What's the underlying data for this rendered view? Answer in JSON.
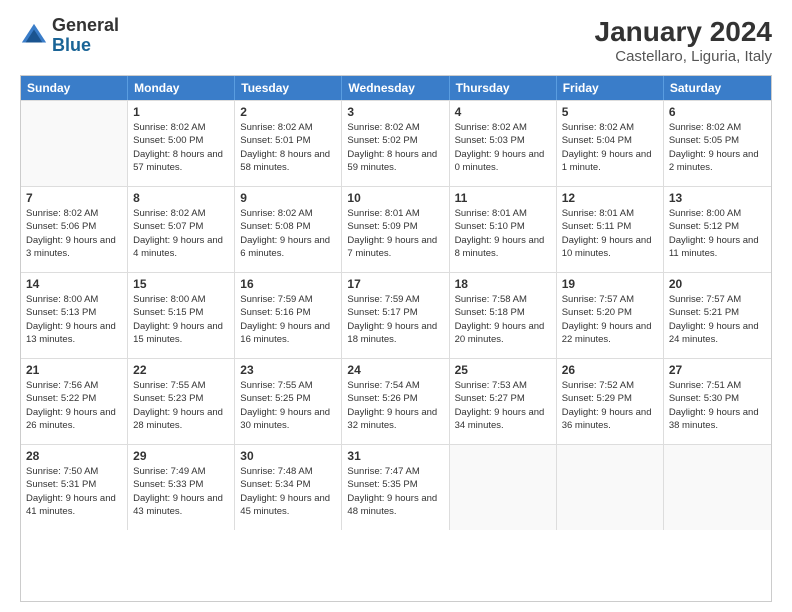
{
  "header": {
    "logo": {
      "general": "General",
      "blue": "Blue"
    },
    "title": "January 2024",
    "subtitle": "Castellaro, Liguria, Italy"
  },
  "calendar": {
    "days_of_week": [
      "Sunday",
      "Monday",
      "Tuesday",
      "Wednesday",
      "Thursday",
      "Friday",
      "Saturday"
    ],
    "weeks": [
      [
        {
          "day": "",
          "empty": true
        },
        {
          "day": "1",
          "sunrise": "Sunrise: 8:02 AM",
          "sunset": "Sunset: 5:00 PM",
          "daylight": "Daylight: 8 hours and 57 minutes."
        },
        {
          "day": "2",
          "sunrise": "Sunrise: 8:02 AM",
          "sunset": "Sunset: 5:01 PM",
          "daylight": "Daylight: 8 hours and 58 minutes."
        },
        {
          "day": "3",
          "sunrise": "Sunrise: 8:02 AM",
          "sunset": "Sunset: 5:02 PM",
          "daylight": "Daylight: 8 hours and 59 minutes."
        },
        {
          "day": "4",
          "sunrise": "Sunrise: 8:02 AM",
          "sunset": "Sunset: 5:03 PM",
          "daylight": "Daylight: 9 hours and 0 minutes."
        },
        {
          "day": "5",
          "sunrise": "Sunrise: 8:02 AM",
          "sunset": "Sunset: 5:04 PM",
          "daylight": "Daylight: 9 hours and 1 minute."
        },
        {
          "day": "6",
          "sunrise": "Sunrise: 8:02 AM",
          "sunset": "Sunset: 5:05 PM",
          "daylight": "Daylight: 9 hours and 2 minutes."
        }
      ],
      [
        {
          "day": "7",
          "sunrise": "Sunrise: 8:02 AM",
          "sunset": "Sunset: 5:06 PM",
          "daylight": "Daylight: 9 hours and 3 minutes."
        },
        {
          "day": "8",
          "sunrise": "Sunrise: 8:02 AM",
          "sunset": "Sunset: 5:07 PM",
          "daylight": "Daylight: 9 hours and 4 minutes."
        },
        {
          "day": "9",
          "sunrise": "Sunrise: 8:02 AM",
          "sunset": "Sunset: 5:08 PM",
          "daylight": "Daylight: 9 hours and 6 minutes."
        },
        {
          "day": "10",
          "sunrise": "Sunrise: 8:01 AM",
          "sunset": "Sunset: 5:09 PM",
          "daylight": "Daylight: 9 hours and 7 minutes."
        },
        {
          "day": "11",
          "sunrise": "Sunrise: 8:01 AM",
          "sunset": "Sunset: 5:10 PM",
          "daylight": "Daylight: 9 hours and 8 minutes."
        },
        {
          "day": "12",
          "sunrise": "Sunrise: 8:01 AM",
          "sunset": "Sunset: 5:11 PM",
          "daylight": "Daylight: 9 hours and 10 minutes."
        },
        {
          "day": "13",
          "sunrise": "Sunrise: 8:00 AM",
          "sunset": "Sunset: 5:12 PM",
          "daylight": "Daylight: 9 hours and 11 minutes."
        }
      ],
      [
        {
          "day": "14",
          "sunrise": "Sunrise: 8:00 AM",
          "sunset": "Sunset: 5:13 PM",
          "daylight": "Daylight: 9 hours and 13 minutes."
        },
        {
          "day": "15",
          "sunrise": "Sunrise: 8:00 AM",
          "sunset": "Sunset: 5:15 PM",
          "daylight": "Daylight: 9 hours and 15 minutes."
        },
        {
          "day": "16",
          "sunrise": "Sunrise: 7:59 AM",
          "sunset": "Sunset: 5:16 PM",
          "daylight": "Daylight: 9 hours and 16 minutes."
        },
        {
          "day": "17",
          "sunrise": "Sunrise: 7:59 AM",
          "sunset": "Sunset: 5:17 PM",
          "daylight": "Daylight: 9 hours and 18 minutes."
        },
        {
          "day": "18",
          "sunrise": "Sunrise: 7:58 AM",
          "sunset": "Sunset: 5:18 PM",
          "daylight": "Daylight: 9 hours and 20 minutes."
        },
        {
          "day": "19",
          "sunrise": "Sunrise: 7:57 AM",
          "sunset": "Sunset: 5:20 PM",
          "daylight": "Daylight: 9 hours and 22 minutes."
        },
        {
          "day": "20",
          "sunrise": "Sunrise: 7:57 AM",
          "sunset": "Sunset: 5:21 PM",
          "daylight": "Daylight: 9 hours and 24 minutes."
        }
      ],
      [
        {
          "day": "21",
          "sunrise": "Sunrise: 7:56 AM",
          "sunset": "Sunset: 5:22 PM",
          "daylight": "Daylight: 9 hours and 26 minutes."
        },
        {
          "day": "22",
          "sunrise": "Sunrise: 7:55 AM",
          "sunset": "Sunset: 5:23 PM",
          "daylight": "Daylight: 9 hours and 28 minutes."
        },
        {
          "day": "23",
          "sunrise": "Sunrise: 7:55 AM",
          "sunset": "Sunset: 5:25 PM",
          "daylight": "Daylight: 9 hours and 30 minutes."
        },
        {
          "day": "24",
          "sunrise": "Sunrise: 7:54 AM",
          "sunset": "Sunset: 5:26 PM",
          "daylight": "Daylight: 9 hours and 32 minutes."
        },
        {
          "day": "25",
          "sunrise": "Sunrise: 7:53 AM",
          "sunset": "Sunset: 5:27 PM",
          "daylight": "Daylight: 9 hours and 34 minutes."
        },
        {
          "day": "26",
          "sunrise": "Sunrise: 7:52 AM",
          "sunset": "Sunset: 5:29 PM",
          "daylight": "Daylight: 9 hours and 36 minutes."
        },
        {
          "day": "27",
          "sunrise": "Sunrise: 7:51 AM",
          "sunset": "Sunset: 5:30 PM",
          "daylight": "Daylight: 9 hours and 38 minutes."
        }
      ],
      [
        {
          "day": "28",
          "sunrise": "Sunrise: 7:50 AM",
          "sunset": "Sunset: 5:31 PM",
          "daylight": "Daylight: 9 hours and 41 minutes."
        },
        {
          "day": "29",
          "sunrise": "Sunrise: 7:49 AM",
          "sunset": "Sunset: 5:33 PM",
          "daylight": "Daylight: 9 hours and 43 minutes."
        },
        {
          "day": "30",
          "sunrise": "Sunrise: 7:48 AM",
          "sunset": "Sunset: 5:34 PM",
          "daylight": "Daylight: 9 hours and 45 minutes."
        },
        {
          "day": "31",
          "sunrise": "Sunrise: 7:47 AM",
          "sunset": "Sunset: 5:35 PM",
          "daylight": "Daylight: 9 hours and 48 minutes."
        },
        {
          "day": "",
          "empty": true
        },
        {
          "day": "",
          "empty": true
        },
        {
          "day": "",
          "empty": true
        }
      ]
    ]
  }
}
